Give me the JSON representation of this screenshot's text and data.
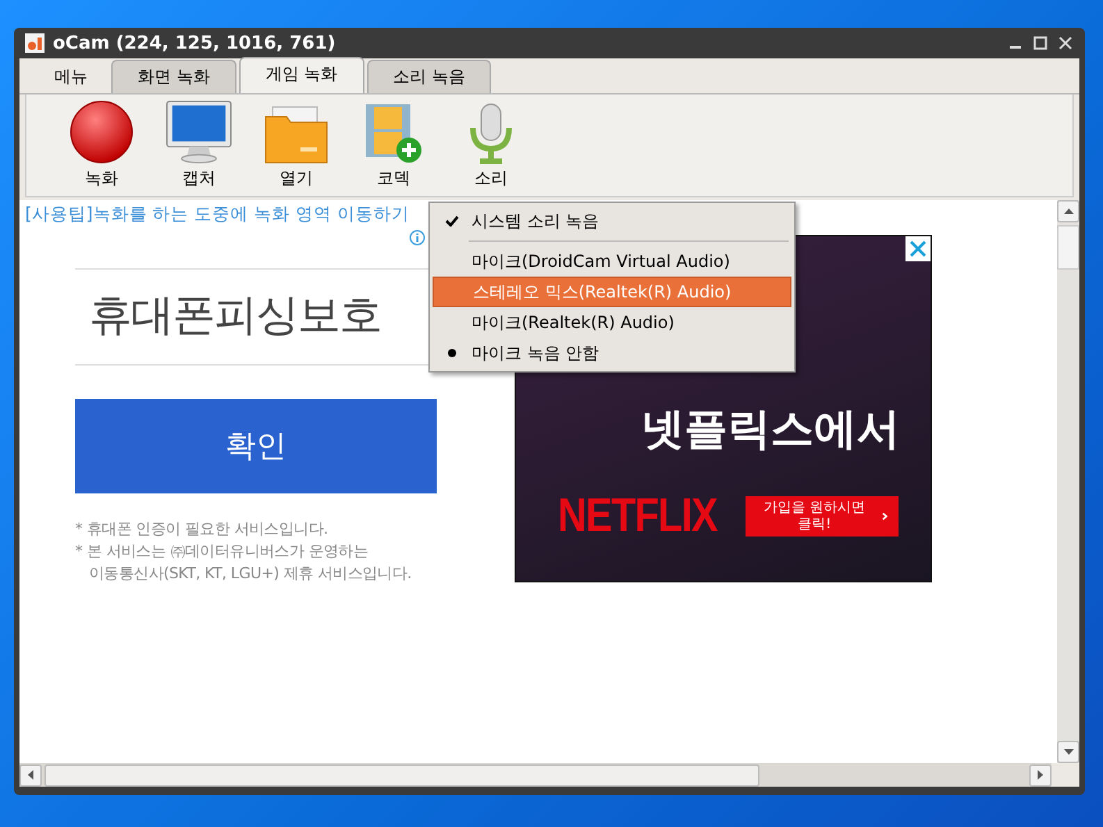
{
  "window": {
    "title": "oCam (224, 125, 1016, 761)"
  },
  "menu_button": "메뉴",
  "tabs": [
    {
      "label": "화면 녹화",
      "selected": false
    },
    {
      "label": "게임 녹화",
      "selected": true
    },
    {
      "label": "소리 녹음",
      "selected": false
    }
  ],
  "toolbar": [
    {
      "label": "녹화",
      "kind": "record"
    },
    {
      "label": "캡처",
      "kind": "capture"
    },
    {
      "label": "열기",
      "kind": "open"
    },
    {
      "label": "코덱",
      "kind": "codec"
    },
    {
      "label": "소리",
      "kind": "sound"
    }
  ],
  "tip": "[사용팁]녹화를 하는 도중에 녹화 영역 이동하기",
  "page": {
    "heading": "휴대폰피싱보호",
    "confirm_button": "확인",
    "notes": [
      "* 휴대폰 인증이 필요한 서비스입니다.",
      "* 본 서비스는 ㈜데이터유니버스가 운영하는",
      "이동통신사(SKT, KT, LGU+) 제휴 서비스입니다."
    ]
  },
  "ad": {
    "lines": [
      "넷플릭스에서"
    ],
    "logo": "NETFLIX",
    "button": "가입을 원하시면 클릭!"
  },
  "sound_menu": {
    "toggles": [
      {
        "label": "시스템 소리 녹음",
        "checked": true,
        "highlighted": false
      }
    ],
    "sources": [
      {
        "label": "마이크(DroidCam Virtual Audio)",
        "checked": false,
        "highlighted": false
      },
      {
        "label": "스테레오 믹스(Realtek(R) Audio)",
        "checked": false,
        "highlighted": true
      },
      {
        "label": "마이크(Realtek(R) Audio)",
        "checked": false,
        "highlighted": false
      },
      {
        "label": "마이크 녹음 안함",
        "checked": true,
        "highlighted": false
      }
    ]
  }
}
